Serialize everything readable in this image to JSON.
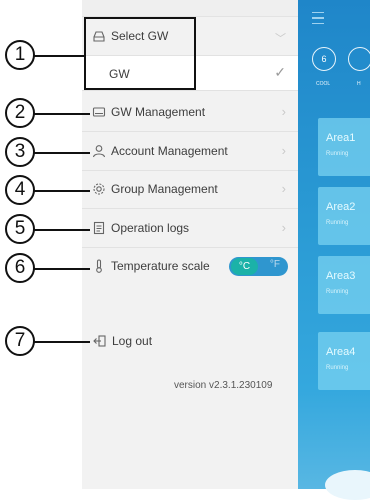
{
  "menu": {
    "select_gw": "Select GW",
    "gw_item": "GW",
    "items": [
      {
        "label": "GW Management"
      },
      {
        "label": "Account Management"
      },
      {
        "label": "Group Management"
      },
      {
        "label": "Operation logs"
      }
    ],
    "temperature_scale": "Temperature scale",
    "toggle": {
      "celsius": "°C",
      "fahrenheit": "°F",
      "selected": "°C"
    },
    "logout": "Log out",
    "version": "version v2.3.1.230109"
  },
  "callouts": [
    "1",
    "2",
    "3",
    "4",
    "5",
    "6",
    "7"
  ],
  "background_app": {
    "mode_value": "6",
    "mode_label": "COOL",
    "mode_label2": "H",
    "areas": [
      {
        "name": "Area1",
        "status": "Running"
      },
      {
        "name": "Area2",
        "status": "Running"
      },
      {
        "name": "Area3",
        "status": "Running"
      },
      {
        "name": "Area4",
        "status": "Running"
      }
    ]
  },
  "colors": {
    "app_blue": "#2a9ad4",
    "toggle_blue": "#2f96cf",
    "toggle_active": "#1bb2a8",
    "drawer": "#f2f2f2"
  }
}
